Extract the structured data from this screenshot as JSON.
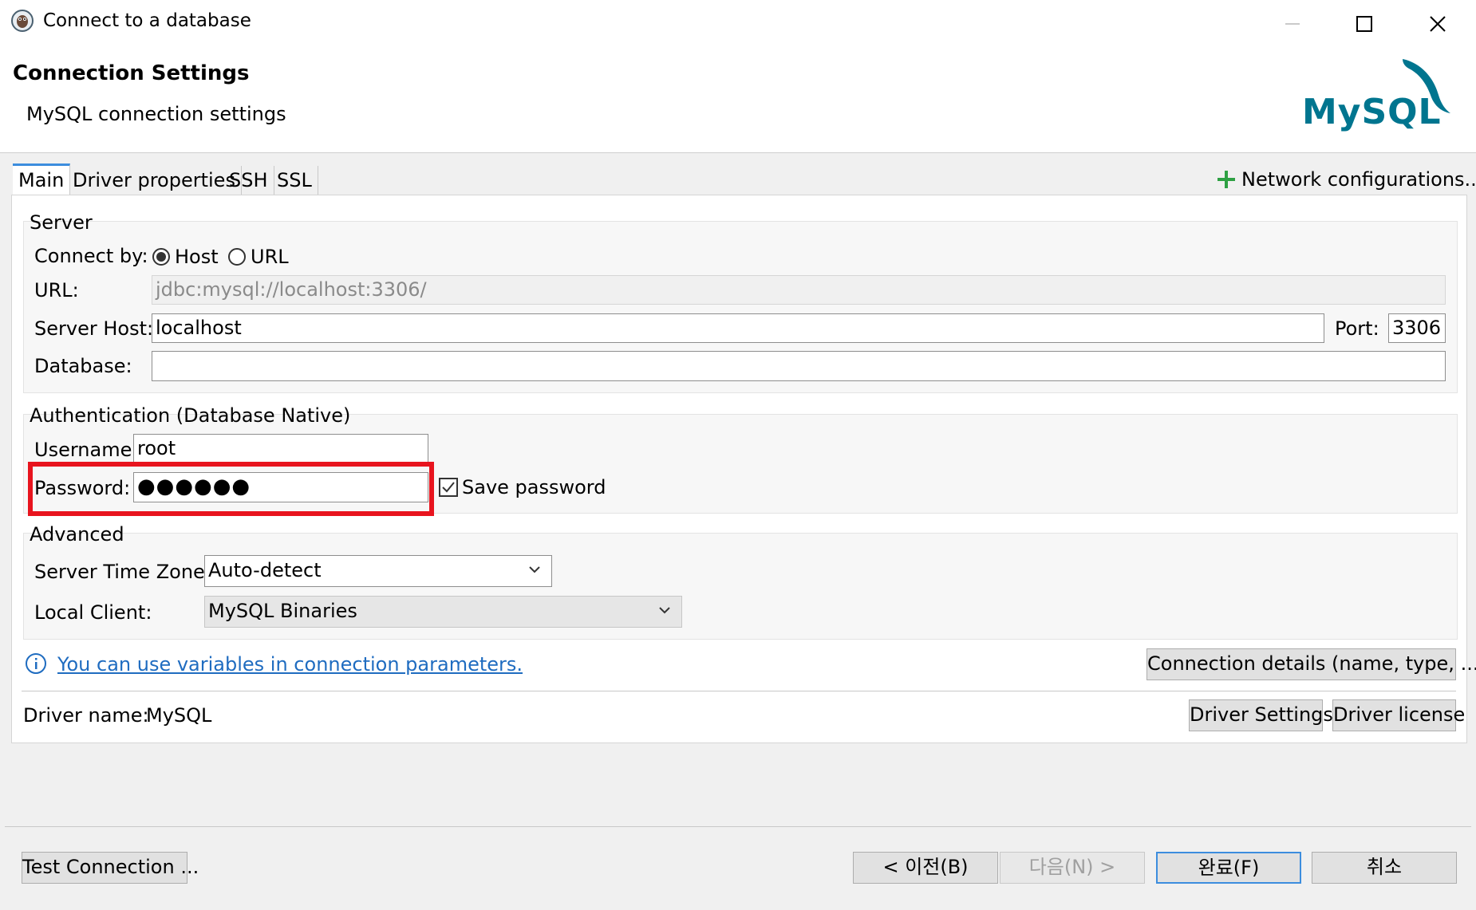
{
  "window": {
    "title": "Connect to a database",
    "icon": "dbeaver-app-icon",
    "controls": [
      "minimize-icon",
      "maximize-icon",
      "close-icon"
    ]
  },
  "header": {
    "title": "Connection Settings",
    "subtitle": "MySQL connection settings",
    "logo_text": "MySQL"
  },
  "tabs": [
    {
      "label": "Main",
      "active": true
    },
    {
      "label": "Driver properties",
      "active": false
    },
    {
      "label": "SSH",
      "active": false
    },
    {
      "label": "SSL",
      "active": false
    }
  ],
  "network_config": {
    "icon": "plus-icon",
    "label": "Network configurations..."
  },
  "server": {
    "group_label": "Server",
    "connect_by_label": "Connect by:",
    "connect_by_options": [
      "Host",
      "URL"
    ],
    "connect_by_selected": "Host",
    "url_label": "URL:",
    "url_value": "jdbc:mysql://localhost:3306/",
    "host_label": "Server Host:",
    "host_value": "localhost",
    "port_label": "Port:",
    "port_value": "3306",
    "database_label": "Database:",
    "database_value": ""
  },
  "auth": {
    "group_label": "Authentication (Database Native)",
    "username_label": "Username:",
    "username_value": "root",
    "password_label": "Password:",
    "password_value": "●●●●●●",
    "save_password_label": "Save password",
    "save_password_checked": true
  },
  "advanced": {
    "group_label": "Advanced",
    "timezone_label": "Server Time Zone:",
    "timezone_value": "Auto-detect",
    "local_client_label": "Local Client:",
    "local_client_value": "MySQL Binaries"
  },
  "info": {
    "icon": "info-icon",
    "link_text": "You can use variables in connection parameters.",
    "details_button": "Connection details (name, type, ... )"
  },
  "driver": {
    "name_label": "Driver name:",
    "name_value": "MySQL",
    "settings_button": "Driver Settings",
    "license_button": "Driver license"
  },
  "footer": {
    "test_button": "Test Connection ...",
    "back_button": "< 이전(B)",
    "next_button": "다음(N) >",
    "finish_button": "완료(F)",
    "cancel_button": "취소"
  },
  "colors": {
    "highlight_box": "#e8141e",
    "accent": "#3c8dde",
    "link": "#1f6cc0",
    "plus_green": "#2ea043",
    "mysql_blue": "#00758f",
    "mysql_orange": "#f29111"
  }
}
